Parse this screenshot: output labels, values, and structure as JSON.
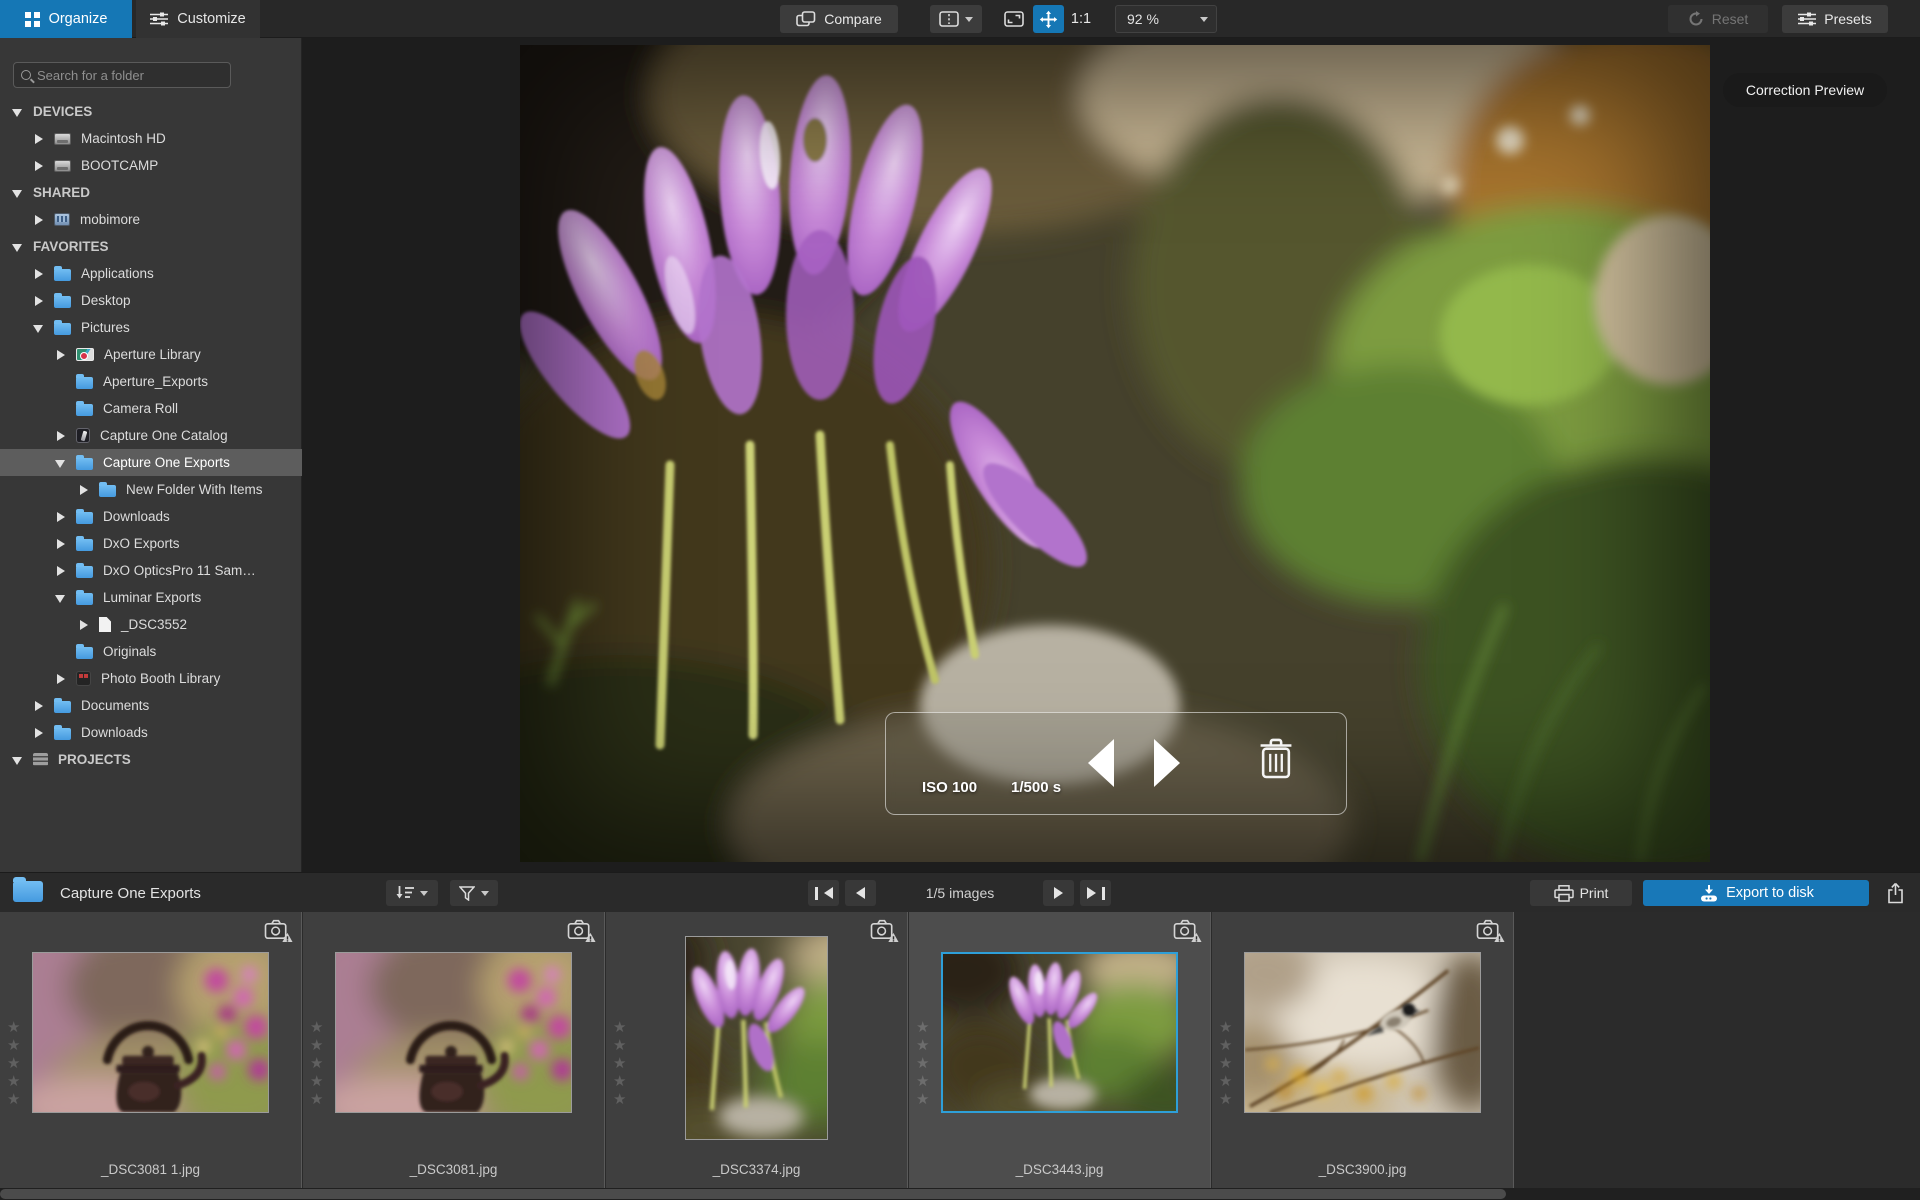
{
  "toolbar": {
    "organize_tab": "Organize",
    "customize_tab": "Customize",
    "compare_button": "Compare",
    "actual_size_button": "1:1",
    "zoom_level": "92 %",
    "reset_button": "Reset",
    "presets_button": "Presets"
  },
  "sidebar": {
    "search_placeholder": "Search for a folder",
    "items": [
      {
        "label": "DEVICES",
        "type": "section",
        "expanded": true
      },
      {
        "label": "Macintosh HD",
        "icon": "drive"
      },
      {
        "label": "BOOTCAMP",
        "icon": "drive"
      },
      {
        "label": "SHARED",
        "type": "section",
        "expanded": true
      },
      {
        "label": "mobimore",
        "icon": "network-display"
      },
      {
        "label": "FAVORITES",
        "type": "section",
        "expanded": true
      },
      {
        "label": "Applications",
        "icon": "folder"
      },
      {
        "label": "Desktop",
        "icon": "folder"
      },
      {
        "label": "Pictures",
        "icon": "folder",
        "expanded": true
      },
      {
        "label": "Aperture Library",
        "icon": "aperture-library"
      },
      {
        "label": "Aperture_Exports",
        "icon": "folder"
      },
      {
        "label": "Camera Roll",
        "icon": "folder"
      },
      {
        "label": "Capture One Catalog",
        "icon": "catalog"
      },
      {
        "label": "Capture One Exports",
        "icon": "folder",
        "expanded": true,
        "selected": true
      },
      {
        "label": "New Folder With Items",
        "icon": "folder"
      },
      {
        "label": "Downloads",
        "icon": "folder"
      },
      {
        "label": "DxO Exports",
        "icon": "folder"
      },
      {
        "label": "DxO OpticsPro 11 Sam…",
        "icon": "folder"
      },
      {
        "label": "Luminar Exports",
        "icon": "folder",
        "expanded": true
      },
      {
        "label": "_DSC3552",
        "icon": "document"
      },
      {
        "label": "Originals",
        "icon": "folder"
      },
      {
        "label": "Photo Booth Library",
        "icon": "photo-booth"
      },
      {
        "label": "Documents",
        "icon": "folder"
      },
      {
        "label": "Downloads",
        "icon": "folder"
      },
      {
        "label": "PROJECTS",
        "type": "section",
        "icon": "projects-db",
        "expanded": true
      }
    ]
  },
  "viewer": {
    "correction_preview_button": "Correction Preview",
    "exif": {
      "iso": "ISO 100",
      "shutter_speed": "1/500 s"
    }
  },
  "filmstrip": {
    "folder_title": "Capture One Exports",
    "position_indicator": "1/5 images",
    "print_button": "Print",
    "export_button": "Export to disk",
    "thumbnails": [
      {
        "filename": "_DSC3081 1.jpg",
        "selected": false,
        "rating": 0
      },
      {
        "filename": "_DSC3081.jpg",
        "selected": false,
        "rating": 0
      },
      {
        "filename": "_DSC3374.jpg",
        "selected": false,
        "rating": 0
      },
      {
        "filename": "_DSC3443.jpg",
        "selected": true,
        "rating": 0
      },
      {
        "filename": "_DSC3900.jpg",
        "selected": false,
        "rating": 0
      }
    ]
  },
  "icons": {
    "star": "★"
  },
  "colors": {
    "accent_blue": "#1577b5",
    "selection_blue": "#2e9fd8",
    "export_button_blue": "#1878b8"
  }
}
